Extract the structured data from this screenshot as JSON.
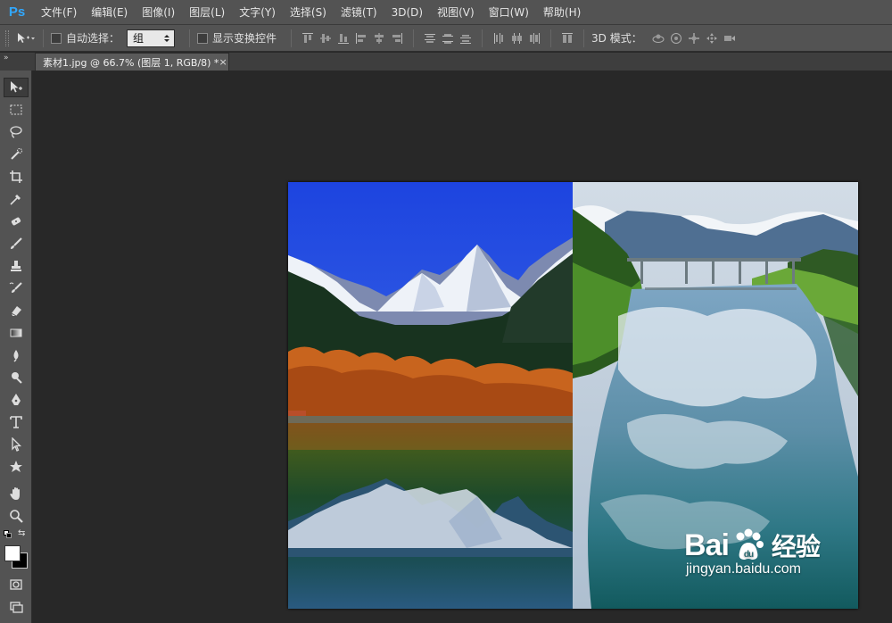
{
  "app": {
    "logo": "Ps",
    "menu": [
      {
        "id": "file",
        "label": "文件(F)"
      },
      {
        "id": "edit",
        "label": "编辑(E)"
      },
      {
        "id": "image",
        "label": "图像(I)"
      },
      {
        "id": "layer",
        "label": "图层(L)"
      },
      {
        "id": "type",
        "label": "文字(Y)"
      },
      {
        "id": "select",
        "label": "选择(S)"
      },
      {
        "id": "filter",
        "label": "滤镜(T)"
      },
      {
        "id": "3d",
        "label": "3D(D)"
      },
      {
        "id": "view",
        "label": "视图(V)"
      },
      {
        "id": "window",
        "label": "窗口(W)"
      },
      {
        "id": "help",
        "label": "帮助(H)"
      }
    ]
  },
  "options": {
    "auto_select_label": "自动选择：",
    "auto_select_value": "组",
    "show_transform_label": "显示变换控件",
    "mode_3d_label": "3D 模式："
  },
  "tab": {
    "panel_collapse": "»",
    "title": "素材1.jpg @ 66.7% (图层 1, RGB/8) *",
    "close": "×"
  },
  "watermark": {
    "logo_left": "Bai",
    "logo_right": "du",
    "logo_cn": "经验",
    "url": "jingyan.baidu.com"
  },
  "colors": {
    "accent": "#31a8ff",
    "panel": "#535353",
    "workspace": "#282828",
    "foreground": "#ffffff",
    "background": "#000000"
  },
  "tools": [
    "move-tool-icon",
    "marquee-tool-icon",
    "lasso-tool-icon",
    "quick-select-tool-icon",
    "crop-tool-icon",
    "eyedropper-tool-icon",
    "healing-brush-tool-icon",
    "brush-tool-icon",
    "clone-stamp-tool-icon",
    "history-brush-tool-icon",
    "eraser-tool-icon",
    "gradient-tool-icon",
    "blur-tool-icon",
    "dodge-tool-icon",
    "pen-tool-icon",
    "type-tool-icon",
    "path-select-tool-icon",
    "custom-shape-tool-icon",
    "hand-tool-icon",
    "zoom-tool-icon"
  ]
}
